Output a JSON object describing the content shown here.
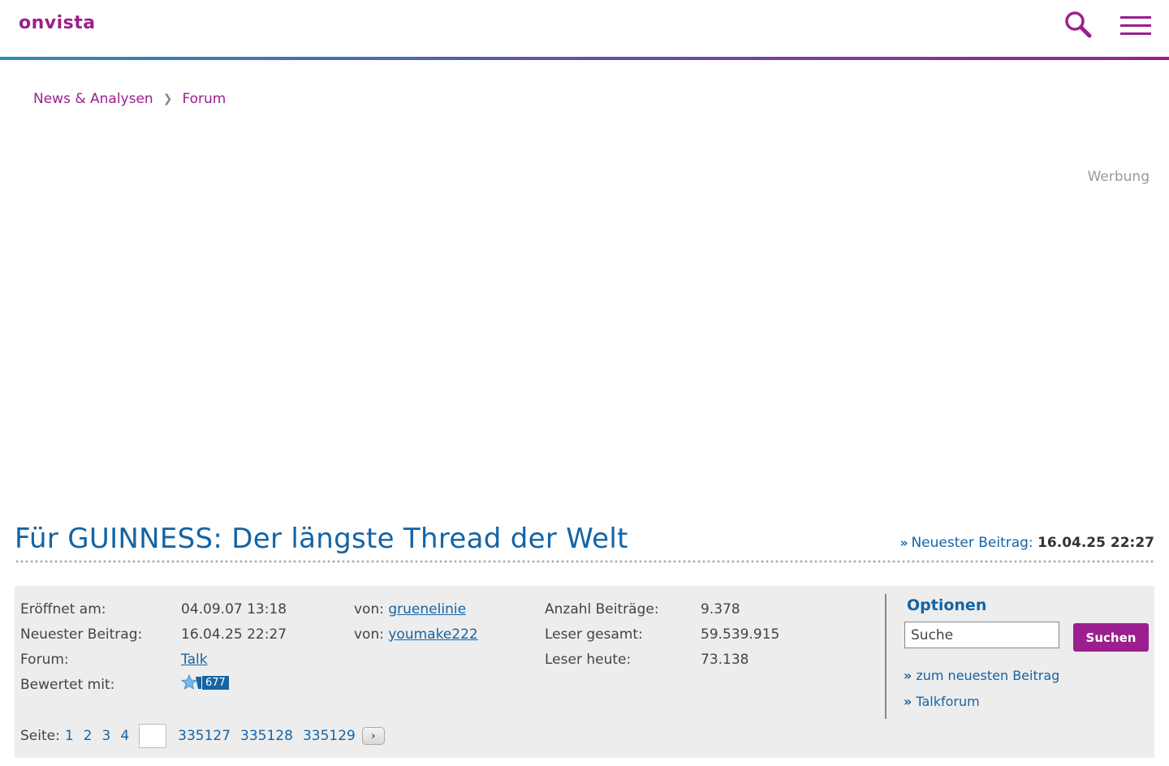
{
  "header": {
    "logo_text": "onvista",
    "icons": {
      "search": "search-icon",
      "menu": "hamburger-menu-icon"
    },
    "accent_color": "#9b1f8e"
  },
  "breadcrumb": {
    "items": [
      "News & Analysen",
      "Forum"
    ],
    "separator": "❯"
  },
  "ad": {
    "label": "Werbung"
  },
  "thread": {
    "title": "Für GUINNESS: Der längste Thread der Welt",
    "latest_label": "Neuester Beitrag:",
    "latest_value": "16.04.25 22:27"
  },
  "info": {
    "opened_label": "Eröffnet am:",
    "opened_value": "04.09.07 13:18",
    "opened_by_label": "von:",
    "opened_by": "gruenelinie",
    "latest_label": "Neuester Beitrag:",
    "latest_value": "16.04.25 22:27",
    "latest_by_label": "von:",
    "latest_by": "youmake222",
    "forum_label": "Forum:",
    "forum_value": "Talk",
    "rated_label": "Bewertet mit:",
    "rating_count": "677",
    "posts_label": "Anzahl Beiträge:",
    "posts_value": "9.378",
    "readers_total_label": "Leser gesamt:",
    "readers_total_value": "59.539.915",
    "readers_today_label": "Leser heute:",
    "readers_today_value": "73.138"
  },
  "options": {
    "title": "Optionen",
    "search_value": "Suche",
    "search_button": "Suchen",
    "links": [
      "zum neuesten Beitrag",
      "Talkforum"
    ]
  },
  "pager": {
    "label": "Seite:",
    "pages_start": [
      "1",
      "2",
      "3",
      "4"
    ],
    "pages_end": [
      "335127",
      "335128",
      "335129"
    ],
    "next_symbol": "›"
  }
}
